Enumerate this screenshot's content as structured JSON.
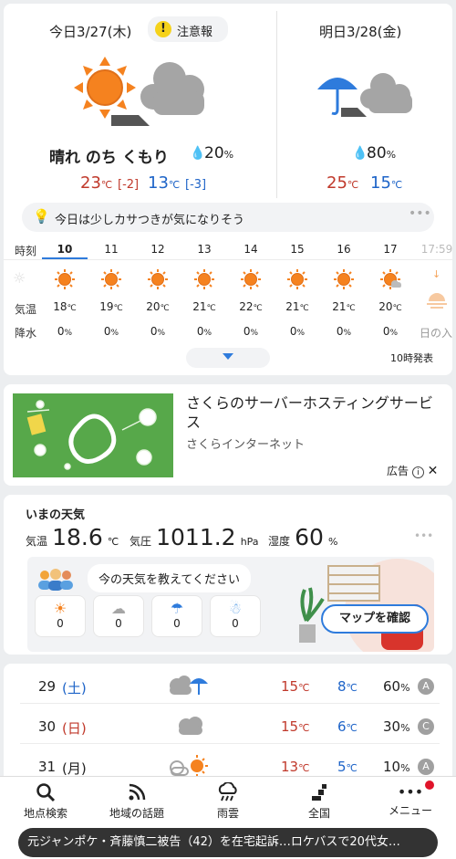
{
  "today": {
    "title": "今日3/27(木)",
    "alert": "注意報",
    "condition": "晴れ のち くもり",
    "precip": "20",
    "precip_unit": "%",
    "high": "23",
    "high_diff": "[-2]",
    "low": "13",
    "low_diff": "[-3]",
    "unit": "℃"
  },
  "tomorrow": {
    "title": "明日3/28(金)",
    "precip": "80",
    "precip_unit": "%",
    "high": "25",
    "low": "15",
    "unit": "℃"
  },
  "tip": "今日は少しカサつきが気になりそう",
  "hourly": {
    "labels": {
      "time": "時刻",
      "temp": "気温",
      "rain": "降水"
    },
    "hours": [
      "10",
      "11",
      "12",
      "13",
      "14",
      "15",
      "16",
      "17",
      "17:59"
    ],
    "temps": [
      "18",
      "19",
      "20",
      "21",
      "22",
      "21",
      "21",
      "20"
    ],
    "rains": [
      "0",
      "0",
      "0",
      "0",
      "0",
      "0",
      "0",
      "0"
    ],
    "temp_unit": "℃",
    "rain_unit": "%",
    "sunset_label": "日の入",
    "issued": "10時発表"
  },
  "ad": {
    "title": "さくらのサーバーホスティングサービス",
    "advertiser": "さくらインターネット",
    "label": "広告"
  },
  "current": {
    "heading": "いまの天気",
    "temp_label": "気温",
    "temp": "18.6",
    "temp_unit": "℃",
    "pressure_label": "気圧",
    "pressure": "1011.2",
    "pressure_unit": "hPa",
    "humidity_label": "湿度",
    "humidity": "60",
    "humidity_unit": "%",
    "prompt": "今の天気を教えてください",
    "map_button": "マップを確認",
    "votes": [
      "0",
      "0",
      "0",
      "0"
    ]
  },
  "weekly": [
    {
      "day": "29",
      "dow": "(土)",
      "high": "15",
      "low": "8",
      "precip": "60",
      "badge": "A"
    },
    {
      "day": "30",
      "dow": "(日)",
      "high": "15",
      "low": "6",
      "precip": "30",
      "badge": "C"
    },
    {
      "day": "31",
      "dow": "(月)",
      "high": "13",
      "low": "5",
      "precip": "10",
      "badge": "A"
    }
  ],
  "weekly_units": {
    "temp": "℃",
    "precip": "%"
  },
  "nav": [
    {
      "label": "地点検索",
      "icon": "search-icon"
    },
    {
      "label": "地域の話題",
      "icon": "rss-icon"
    },
    {
      "label": "雨雲",
      "icon": "rain-cloud-icon"
    },
    {
      "label": "全国",
      "icon": "japan-map-icon"
    },
    {
      "label": "メニュー",
      "icon": "more-icon"
    }
  ],
  "news_ticker": "元ジャンポケ・斉藤慎二被告（42）を在宅起訴…ロケバスで20代女…",
  "colors": {
    "sun": "#f5821f",
    "umbrella": "#2e7bdc",
    "cloud": "#a5a5a5",
    "red": "#c0392b",
    "blue": "#1e64c8",
    "alert": "#f5d21b"
  }
}
